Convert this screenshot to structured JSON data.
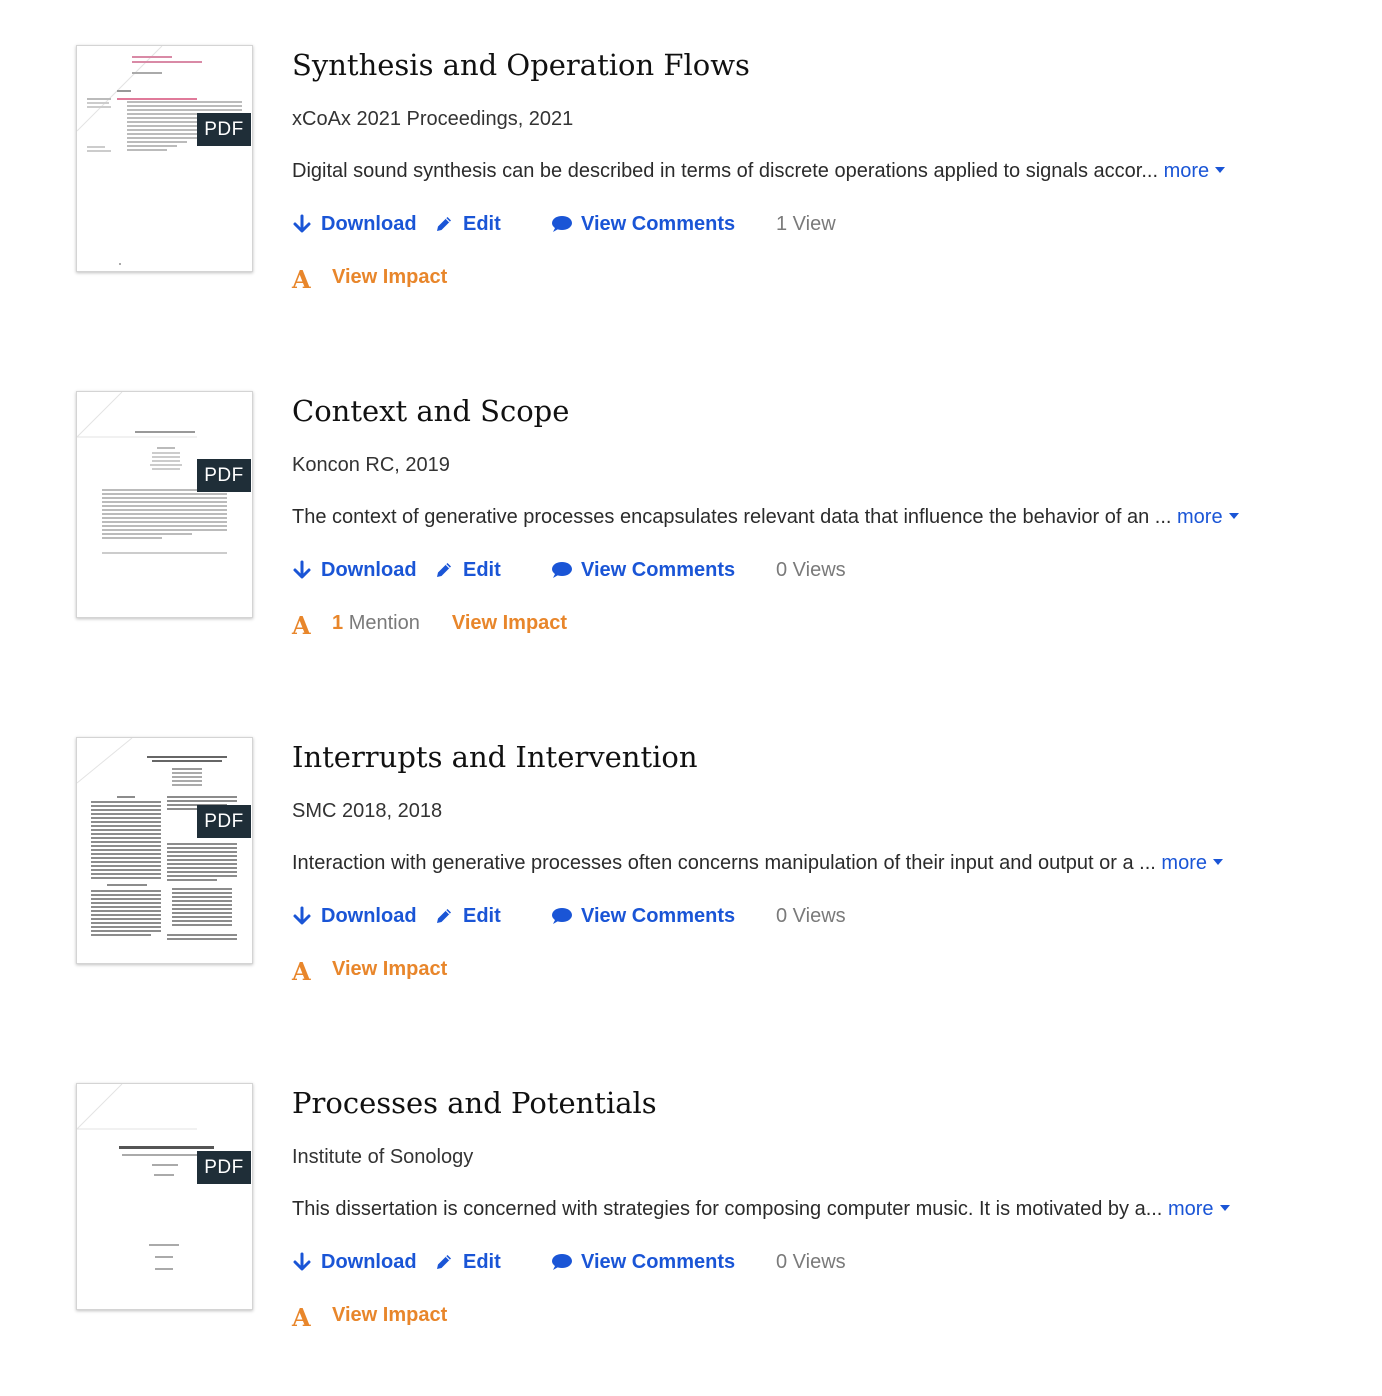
{
  "works": [
    {
      "title": "Synthesis and Operation Flows",
      "venue": "xCoAx 2021 Proceedings, 2021",
      "abstract": "Digital sound synthesis can be described in terms of discrete operations applied to signals accor...",
      "more": "more",
      "download": "Download",
      "edit": "Edit",
      "comments": "View Comments",
      "views": "1 View",
      "view_impact": "View Impact",
      "badge": "PDF",
      "thumb_title": "Synthesis and Operation Flows"
    },
    {
      "title": "Context and Scope",
      "venue": "Koncon RC, 2019",
      "abstract": "The context of generative processes encapsulates relevant data that influence the behavior of an ...",
      "more": "more",
      "download": "Download",
      "edit": "Edit",
      "comments": "View Comments",
      "views": "0 Views",
      "mention_count": "1",
      "mention_label": "Mention",
      "view_impact": "View Impact",
      "badge": "PDF",
      "thumb_title": "Context and Scope"
    },
    {
      "title": "Interrupts and Intervention",
      "venue": "SMC 2018, 2018",
      "abstract": "Interaction with generative processes often concerns manipulation of their input and output or a ...",
      "more": "more",
      "download": "Download",
      "edit": "Edit",
      "comments": "View Comments",
      "views": "0 Views",
      "view_impact": "View Impact",
      "badge": "PDF"
    },
    {
      "title": "Processes and Potentials",
      "venue": "Institute of Sonology",
      "abstract": "This dissertation is concerned with strategies for composing computer music. It is motivated by a...",
      "more": "more",
      "download": "Download",
      "edit": "Edit",
      "comments": "View Comments",
      "views": "0 Views",
      "view_impact": "View Impact",
      "badge": "PDF",
      "thumb_title": "Processes and Potentials"
    }
  ],
  "icons": {
    "download": "arrow-down-icon",
    "edit": "pencil-icon",
    "comments": "speech-bubble-icon",
    "impact": "letter-a-icon",
    "more": "caret-down-icon"
  },
  "colors": {
    "link_blue": "#1a55d6",
    "impact_orange": "#e8862b",
    "muted_gray": "#7a7a7a",
    "pdf_badge": "#1f2e38"
  }
}
